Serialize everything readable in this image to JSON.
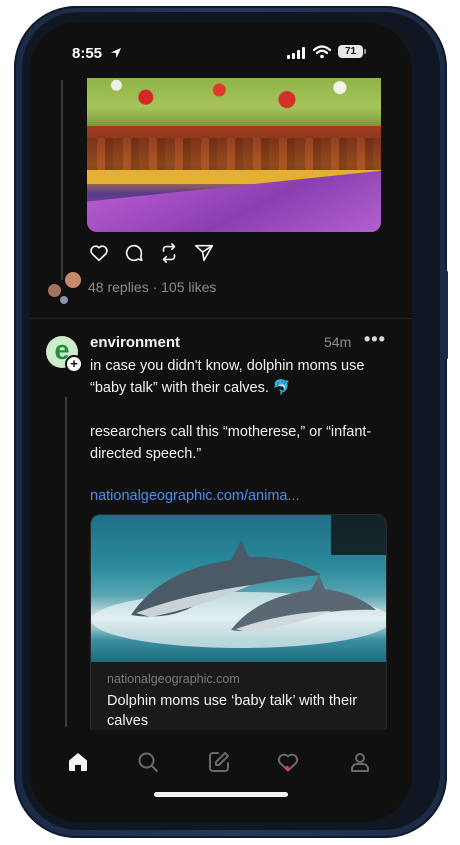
{
  "status_bar": {
    "time": "8:55",
    "battery": "71"
  },
  "post_top": {
    "stats": "48 replies · 105 likes"
  },
  "post": {
    "username": "environment",
    "avatar_letter": "e",
    "time": "54m",
    "more": "•••",
    "text_line1": "in case you didn't know, dolphin moms use “baby talk” with their calves. 🐬",
    "text_line2": "researchers call this “motherese,” or “infant-directed speech.”",
    "link": "nationalgeographic.com/anima...",
    "card": {
      "domain": "nationalgeographic.com",
      "title": "Dolphin moms use ‘baby talk’ with their calves"
    }
  },
  "tabs": [
    "home-icon",
    "search-icon",
    "compose-icon",
    "heart-icon",
    "profile-icon"
  ],
  "colors": {
    "link": "#4d8ef2",
    "badge_dot": "#ff3040",
    "avatar_green": "#1e8f3a"
  }
}
